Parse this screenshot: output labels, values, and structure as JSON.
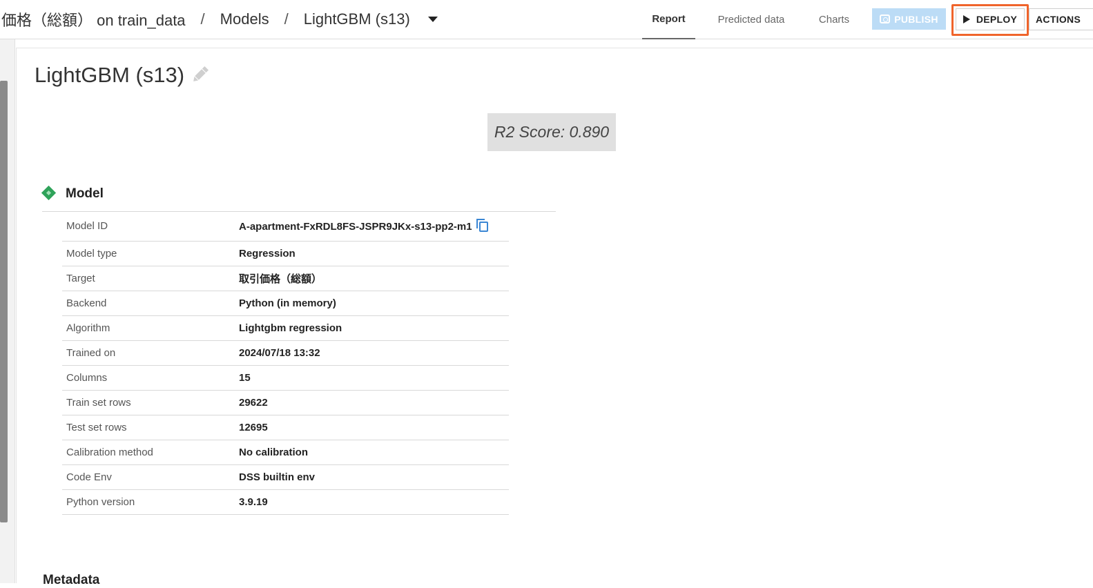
{
  "breadcrumb": {
    "items": [
      "価格（総額） on train_data",
      "Models",
      "LightGBM (s13)"
    ],
    "separator": "/"
  },
  "tabs": [
    {
      "label": "Report",
      "active": true
    },
    {
      "label": "Predicted data",
      "active": false
    },
    {
      "label": "Charts",
      "active": false
    }
  ],
  "buttons": {
    "publish": "PUBLISH",
    "deploy": "DEPLOY",
    "actions": "ACTIONS"
  },
  "model": {
    "title": "LightGBM (s13)",
    "score": "R2 Score: 0.890"
  },
  "section": {
    "title": "Model",
    "rows": [
      {
        "key": "Model ID",
        "value": "A-apartment-FxRDL8FS-JSPR9JKx-s13-pp2-m1",
        "copyable": true
      },
      {
        "key": "Model type",
        "value": "Regression"
      },
      {
        "key": "Target",
        "value": "取引価格（総額）"
      },
      {
        "key": "Backend",
        "value": "Python (in memory)"
      },
      {
        "key": "Algorithm",
        "value": "Lightgbm regression"
      },
      {
        "key": "Trained on",
        "value": "2024/07/18 13:32"
      },
      {
        "key": "Columns",
        "value": "15"
      },
      {
        "key": "Train set rows",
        "value": "29622"
      },
      {
        "key": "Test set rows",
        "value": "12695"
      },
      {
        "key": "Calibration method",
        "value": "No calibration"
      },
      {
        "key": "Code Env",
        "value": "DSS builtin env"
      },
      {
        "key": "Python version",
        "value": "3.9.19"
      }
    ]
  },
  "next_section": {
    "title": "Metadata"
  },
  "colors": {
    "accent_highlight": "#f0642b",
    "publish_bg": "#bcdcf6",
    "model_icon": "#2fa35a",
    "copy_icon": "#3a86d4"
  }
}
